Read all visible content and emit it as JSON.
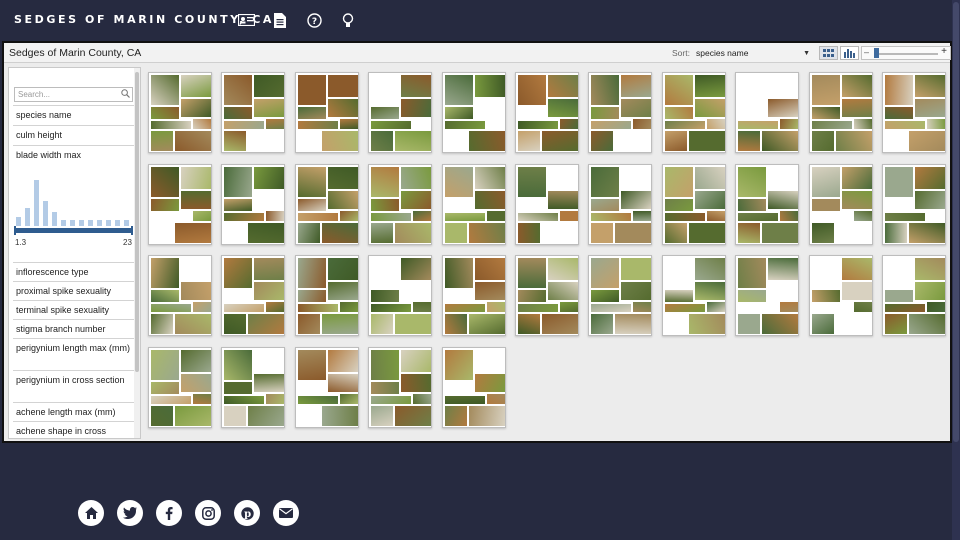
{
  "site": {
    "title": "SEDGES OF MARIN COUNTY, CA",
    "nav_icons": [
      "contact-card-icon",
      "document-icon",
      "help-icon",
      "lightbulb-icon"
    ]
  },
  "viewer": {
    "title": "Sedges of Marin County, CA",
    "sort_label": "Sort:",
    "sort_value": "species name",
    "view_modes": [
      "grid-view-icon",
      "bar-view-icon"
    ],
    "zoom_minus": "–",
    "zoom_plus": "+"
  },
  "sidebar": {
    "search_placeholder": "Search...",
    "facets_top": [
      "species name",
      "culm height",
      "blade width max"
    ],
    "histogram": {
      "range_min": "1.3",
      "range_max": "23",
      "bars": [
        0.2,
        0.4,
        1.0,
        0.55,
        0.3,
        0.12,
        0.12,
        0.12,
        0.12,
        0.12,
        0.12,
        0.12,
        0.12
      ]
    },
    "facets_bottom": [
      "inflorescence type",
      "proximal spike sexuality",
      "terminal spike sexuality",
      "stigma branch number",
      "perigynium length max (mm)",
      "perigynium in cross section",
      "achene length max (mm)",
      "achene shape in cross"
    ]
  },
  "grid": {
    "rows": 4,
    "cols": 11,
    "card_count": 38,
    "palette": [
      "#7a9a3e",
      "#556b2f",
      "#a9b86a",
      "#3f5a26",
      "#c4a06a",
      "#8b5a2b",
      "#d8d1c0",
      "#6e7f48",
      "#b27a3f",
      "#9aa88e",
      "#4a6b3a",
      "#a38a5c"
    ]
  },
  "footer": {
    "social_icons": [
      "home-icon",
      "twitter-icon",
      "facebook-icon",
      "instagram-icon",
      "pinterest-icon",
      "mail-icon"
    ]
  }
}
